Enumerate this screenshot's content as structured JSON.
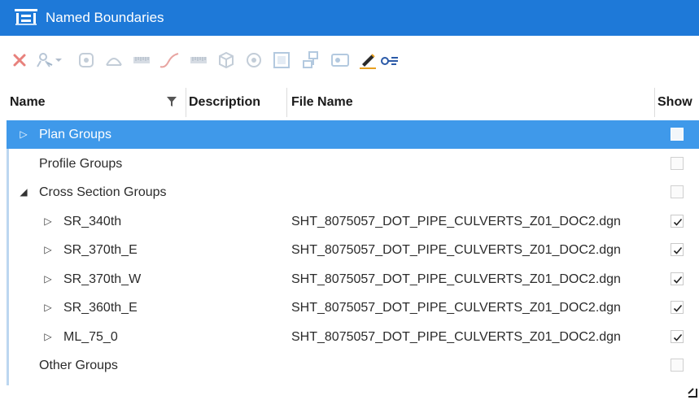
{
  "window": {
    "title": "Named Boundaries",
    "app_icon": "named-boundaries-icon"
  },
  "toolbar": {
    "buttons": [
      {
        "name": "delete-icon",
        "color": "#e0605a"
      },
      {
        "name": "select-user-icon"
      },
      {
        "name": "dropdown-arrow-icon"
      },
      {
        "name": "boundary-icon"
      },
      {
        "name": "arc-icon"
      },
      {
        "name": "ruler-icon"
      },
      {
        "name": "curve-icon"
      },
      {
        "name": "ruler2-icon"
      },
      {
        "name": "cube-icon"
      },
      {
        "name": "camera-settings-icon"
      },
      {
        "name": "fit-view-icon"
      },
      {
        "name": "group-icon"
      },
      {
        "name": "image-icon"
      },
      {
        "name": "pencil-draw-icon",
        "color": "#e8a020"
      },
      {
        "name": "key-list-icon"
      }
    ]
  },
  "columns": {
    "name": "Name",
    "description": "Description",
    "file_name": "File Name",
    "show": "Show"
  },
  "rows": [
    {
      "label": "Plan Groups",
      "expander": "▷",
      "file": "",
      "checked": false,
      "selected": true
    },
    {
      "label": "Profile Groups",
      "expander": "",
      "file": "",
      "checked": false,
      "selected": false
    },
    {
      "label": "Cross Section Groups",
      "expander": "◢",
      "file": "",
      "checked": false,
      "selected": false
    },
    {
      "label": "SR_340th",
      "expander": "▷",
      "file": "SHT_8075057_DOT_PIPE_CULVERTS_Z01_DOC2.dgn",
      "checked": true,
      "selected": false
    },
    {
      "label": "SR_370th_E",
      "expander": "▷",
      "file": "SHT_8075057_DOT_PIPE_CULVERTS_Z01_DOC2.dgn",
      "checked": true,
      "selected": false
    },
    {
      "label": "SR_370th_W",
      "expander": "▷",
      "file": "SHT_8075057_DOT_PIPE_CULVERTS_Z01_DOC2.dgn",
      "checked": true,
      "selected": false
    },
    {
      "label": "SR_360th_E",
      "expander": "▷",
      "file": "SHT_8075057_DOT_PIPE_CULVERTS_Z01_DOC2.dgn",
      "checked": true,
      "selected": false
    },
    {
      "label": "ML_75_0",
      "expander": "▷",
      "file": "SHT_8075057_DOT_PIPE_CULVERTS_Z01_DOC2.dgn",
      "checked": true,
      "selected": false
    },
    {
      "label": "Other Groups",
      "expander": "",
      "file": "",
      "checked": false,
      "selected": false
    }
  ],
  "colors": {
    "titlebar": "#1e79d8",
    "selected_row": "#3f99ea"
  }
}
